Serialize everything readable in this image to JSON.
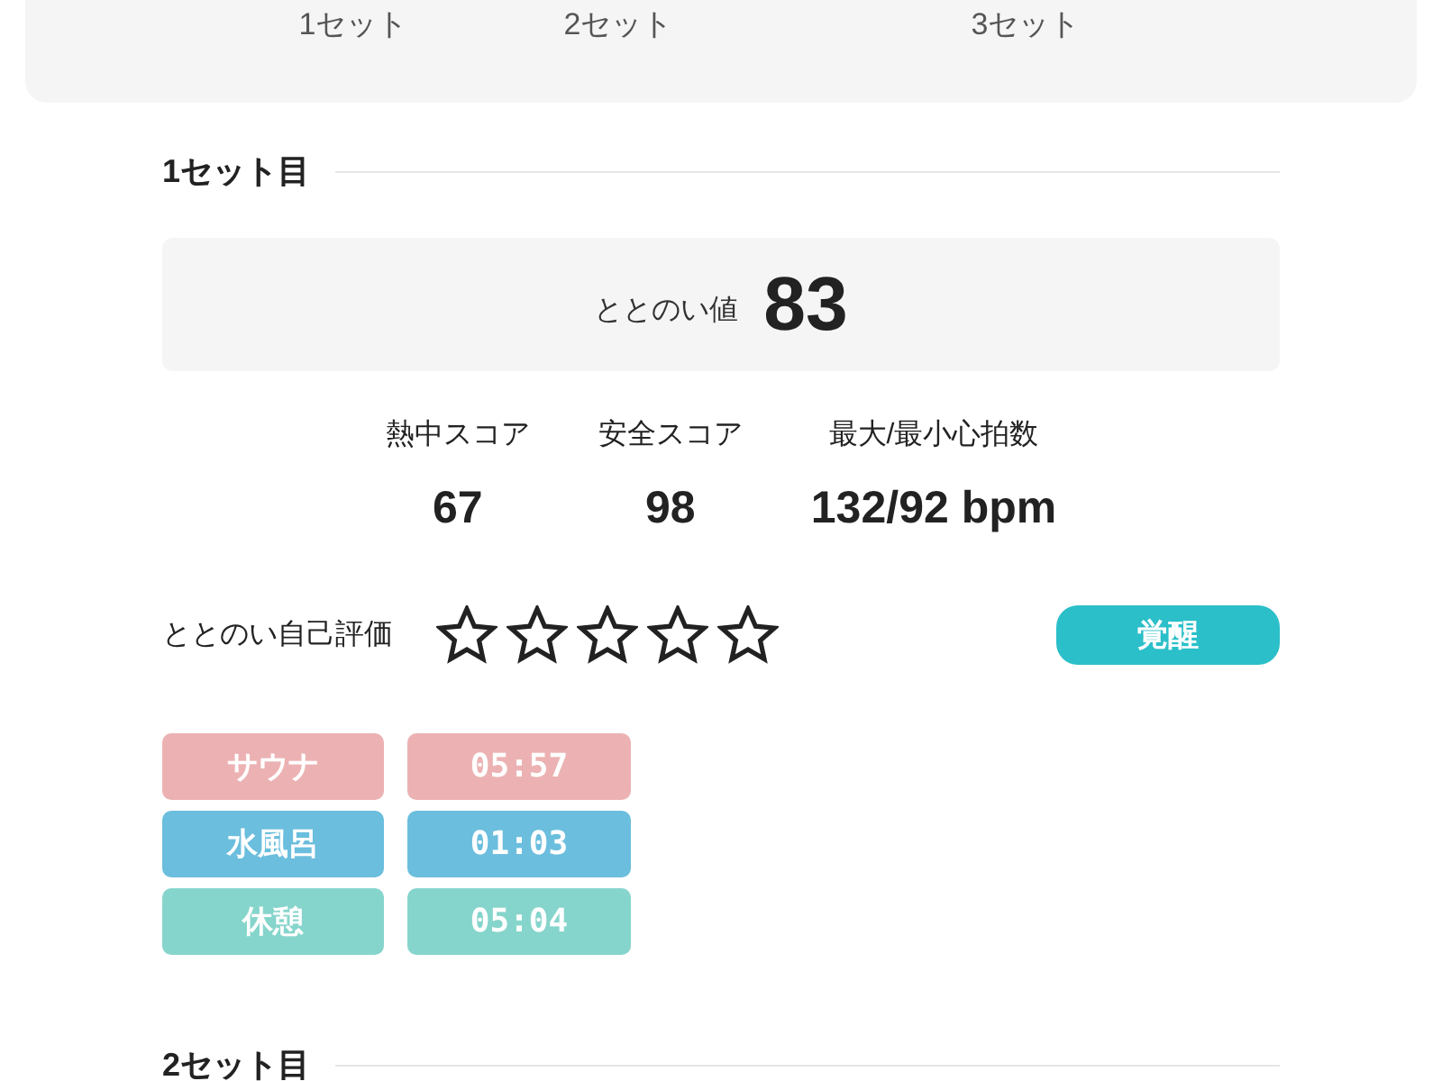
{
  "set_labels": [
    "1セット",
    "2セット",
    "3セット"
  ],
  "sets": [
    {
      "title": "1セット目",
      "totonoi": {
        "label": "ととのい値",
        "value": "83"
      },
      "stats": [
        {
          "label": "熱中スコア",
          "value": "67"
        },
        {
          "label": "安全スコア",
          "value": "98"
        },
        {
          "label": "最大/最小心拍数",
          "value": "132/92 bpm"
        }
      ],
      "rating": {
        "label": "ととのい自己評価",
        "stars": 0
      },
      "status_button": "覚醒",
      "phases": [
        {
          "name": "サウナ",
          "time": "05:57",
          "color": "#ecb2b3"
        },
        {
          "name": "水風呂",
          "time": "01:03",
          "color": "#6bbedd"
        },
        {
          "name": "休憩",
          "time": "05:04",
          "color": "#86d5cc"
        }
      ]
    },
    {
      "title": "2セット目"
    }
  ]
}
